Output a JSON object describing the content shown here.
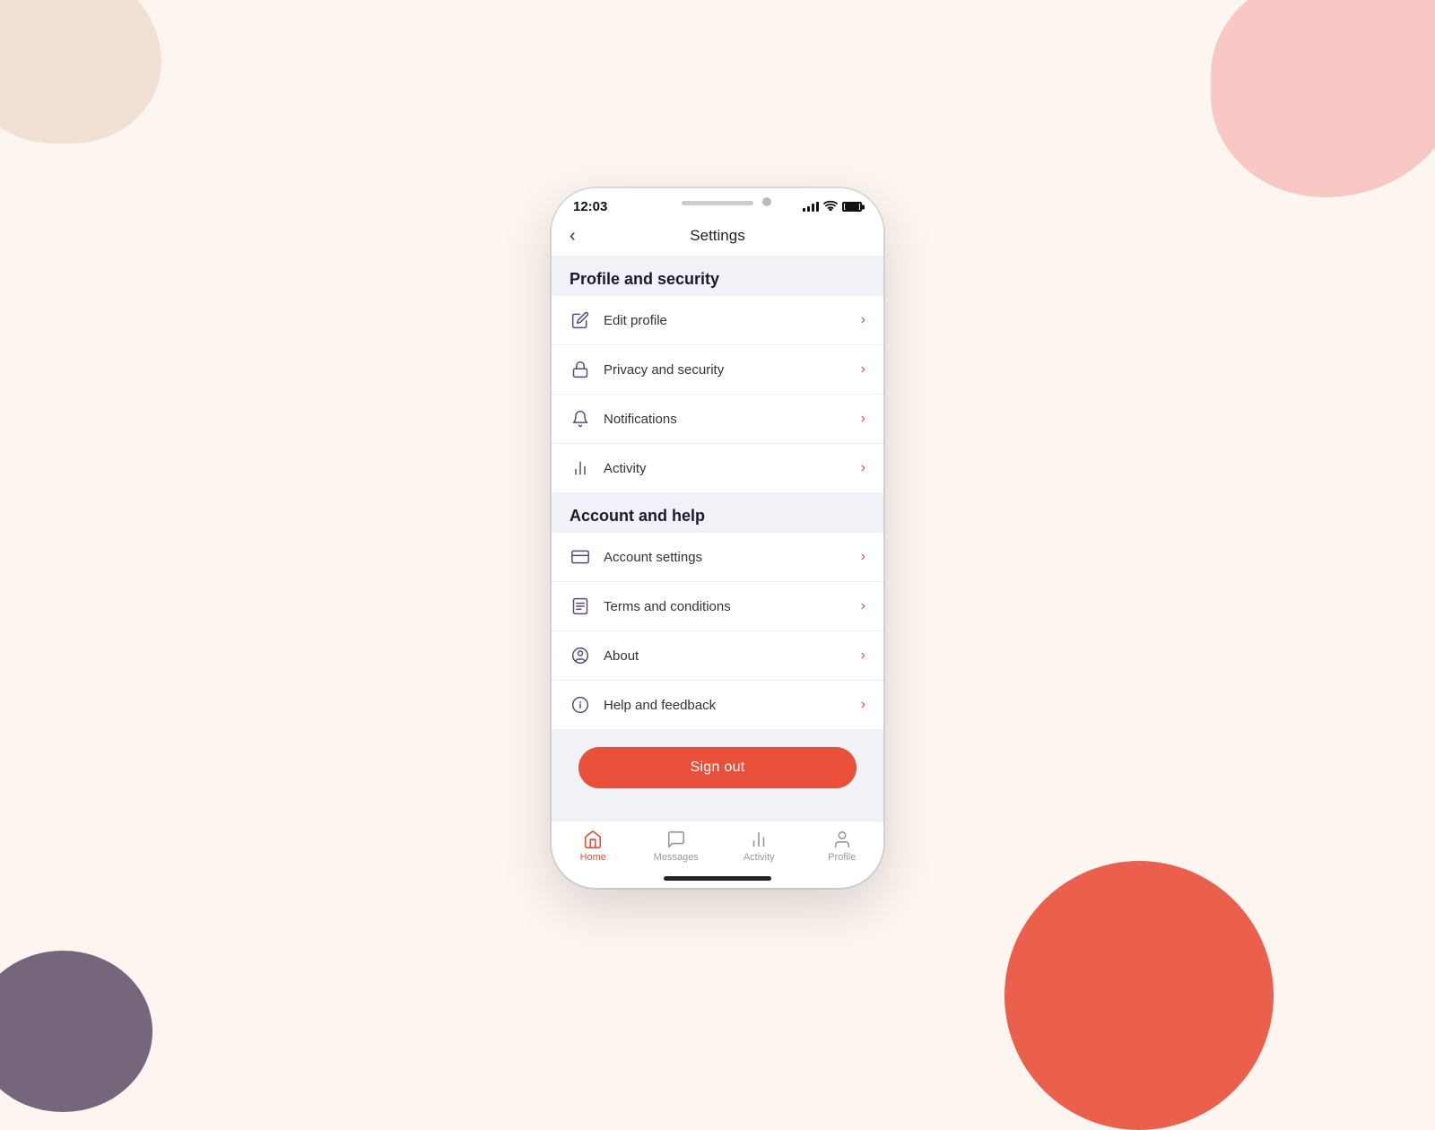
{
  "background": {
    "blobs": [
      "top-left",
      "top-right",
      "bottom-right",
      "bottom-left"
    ]
  },
  "statusBar": {
    "time": "12:03",
    "signalBars": 4,
    "wifi": true,
    "battery": 100
  },
  "header": {
    "title": "Settings",
    "backLabel": "‹"
  },
  "sections": [
    {
      "id": "profile-security",
      "header": "Profile and security",
      "items": [
        {
          "id": "edit-profile",
          "label": "Edit profile",
          "icon": "pencil"
        },
        {
          "id": "privacy-security",
          "label": "Privacy and security",
          "icon": "lock"
        },
        {
          "id": "notifications",
          "label": "Notifications",
          "icon": "bell"
        },
        {
          "id": "activity",
          "label": "Activity",
          "icon": "chart"
        }
      ]
    },
    {
      "id": "account-help",
      "header": "Account and help",
      "items": [
        {
          "id": "account-settings",
          "label": "Account settings",
          "icon": "card"
        },
        {
          "id": "terms-conditions",
          "label": "Terms and conditions",
          "icon": "doc"
        },
        {
          "id": "about",
          "label": "About",
          "icon": "person-circle"
        },
        {
          "id": "help-feedback",
          "label": "Help and feedback",
          "icon": "info-circle"
        }
      ]
    }
  ],
  "signOutButton": "Sign out",
  "bottomNav": {
    "items": [
      {
        "id": "home",
        "label": "Home",
        "icon": "home",
        "active": true
      },
      {
        "id": "messages",
        "label": "Messages",
        "icon": "chat",
        "active": false
      },
      {
        "id": "activity",
        "label": "Activity",
        "icon": "chart-bar",
        "active": false
      },
      {
        "id": "profile",
        "label": "Profile",
        "icon": "person",
        "active": false
      }
    ]
  }
}
